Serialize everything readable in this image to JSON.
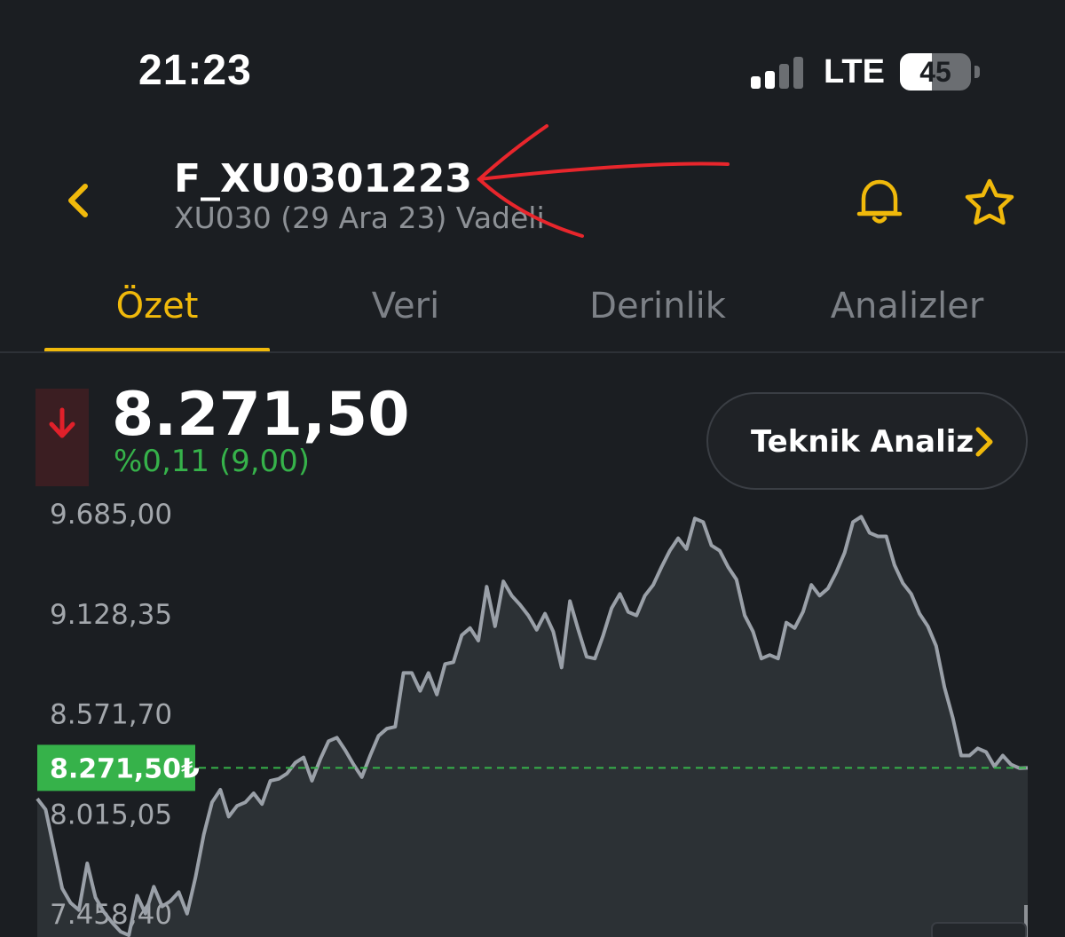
{
  "status": {
    "time": "21:23",
    "network": "LTE",
    "battery": "45",
    "battery_level": 0.45
  },
  "header": {
    "title": "F_XU0301223",
    "subtitle": "XU030 (29 Ara 23) Vadeli"
  },
  "tabs": [
    {
      "label": "Özet",
      "active": true
    },
    {
      "label": "Veri",
      "active": false
    },
    {
      "label": "Derinlik",
      "active": false
    },
    {
      "label": "Analizler",
      "active": false
    }
  ],
  "quote": {
    "price": "8.271,50",
    "change": "%0,11 (9,00)",
    "direction": "down"
  },
  "technical_button": {
    "label": "Teknik Analiz"
  },
  "colors": {
    "accent": "#f0b90b",
    "up": "#36b24a",
    "down": "#e0202a",
    "line": "#9aa0a8",
    "background": "#1b1e22"
  },
  "chart_data": {
    "type": "area",
    "ylim": [
      7330,
      9780
    ],
    "yticks": [
      9685.0,
      9128.35,
      8571.7,
      8015.05,
      7458.4
    ],
    "ytick_labels": [
      "9.685,00",
      "9.128,35",
      "8.571,70",
      "8.015,05",
      "7.458,40"
    ],
    "current_value": 8271.5,
    "current_label": "8.271,50₺",
    "series": [
      {
        "values": [
          8100,
          8040,
          7820,
          7600,
          7520,
          7480,
          7740,
          7550,
          7470,
          7410,
          7360,
          7340,
          7560,
          7460,
          7610,
          7500,
          7530,
          7580,
          7460,
          7660,
          7900,
          8080,
          8150,
          8000,
          8060,
          8080,
          8130,
          8070,
          8200,
          8210,
          8240,
          8300,
          8330,
          8200,
          8320,
          8420,
          8440,
          8370,
          8290,
          8220,
          8340,
          8450,
          8490,
          8500,
          8800,
          8800,
          8700,
          8800,
          8680,
          8850,
          8860,
          9010,
          9050,
          8980,
          9280,
          9060,
          9310,
          9230,
          9180,
          9120,
          9040,
          9130,
          9030,
          8830,
          9200,
          9040,
          8890,
          8880,
          9010,
          9160,
          9240,
          9140,
          9120,
          9230,
          9290,
          9390,
          9480,
          9550,
          9490,
          9660,
          9640,
          9510,
          9480,
          9390,
          9320,
          9120,
          9030,
          8880,
          8900,
          8880,
          9080,
          9050,
          9140,
          9290,
          9230,
          9270,
          9360,
          9470,
          9640,
          9670,
          9580,
          9560,
          9560,
          9400,
          9300,
          9240,
          9130,
          9060,
          8950,
          8720,
          8550,
          8340,
          8340,
          8380,
          8360,
          8280,
          8340,
          8290,
          8270,
          8271.5
        ]
      }
    ]
  }
}
